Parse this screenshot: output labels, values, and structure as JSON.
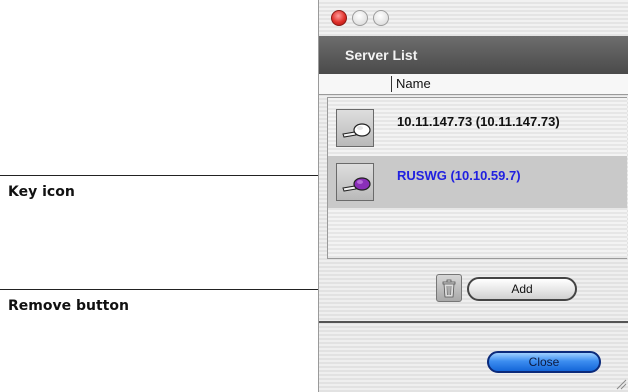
{
  "annotations": {
    "key_icon_label": "Key icon",
    "remove_button_label": "Remove button"
  },
  "window": {
    "header_title": "Server List",
    "column_header": "Name",
    "servers": [
      {
        "name": "10.11.147.73 (10.11.147.73)",
        "selected": false,
        "key_color": "#ffffff"
      },
      {
        "name": "RUSWG (10.10.59.7)",
        "selected": true,
        "key_color": "#8a2fb8"
      }
    ],
    "add_label": "Add",
    "close_label": "Close"
  },
  "colors": {
    "selected_text": "#2020e0",
    "close_button": "#3d8ef0",
    "header_bar": "#555555"
  }
}
